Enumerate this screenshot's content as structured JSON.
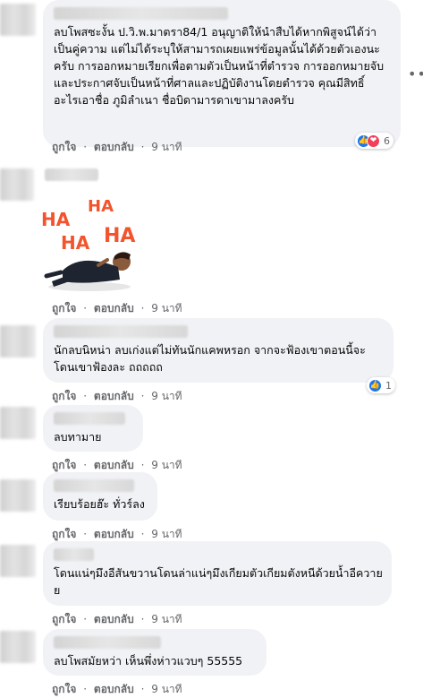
{
  "actions": {
    "like": "ถูกใจ",
    "reply": "ตอบกลับ",
    "sep": "·"
  },
  "comments": [
    {
      "text": "ลบโพสซะงั้น ป.วิ.พ.มาตรา84/1 อนุญาติให้นำสืบได้หากพิสูจน์ได้ว่าเป็นคู่ความ แต่ไม่ได้ระบุให้สามารถเผยแพร่ข้อมูลนั้นได้ด้วยตัวเองนะครับ การออกหมายเรียกเพื่อตามตัวเป็นหน้าที่ตำรวจ การออกหมายจับและประกาศจับเป็นหน้าที่ศาลและปฏิบัติงานโดยตำรวจ คุณมีสิทธิ์อะไรเอาชื่อ ภูมิลำเนา ชื่อบิดามารดาเขามาลงครับ",
      "time": "9 นาที",
      "reactions": {
        "count": "6"
      }
    },
    {
      "sticker": [
        "HA",
        "HA",
        "HA",
        "HA"
      ],
      "time": "9 นาที"
    },
    {
      "text": "นักลบนิหน่า ลบเก่งแต่ไม่ทันนักแคพหรอก จากจะฟ้องเขาตอนนี้จะโดนเขาฟ้องละ ถถถถถ",
      "time": "9 นาที",
      "reactions": {
        "count": "1"
      }
    },
    {
      "text": "ลบทามาย",
      "time": "9 นาที"
    },
    {
      "text": "เรียบร้อยฮ๊ะ ทั่วร์ลง",
      "time": "9 นาที"
    },
    {
      "text": "โดนแน่ๆมึงอีสันขวานโดนล่าแน่ๆมึงเกียมตัวเกียมตังหนีด้วยน้ำอีควายย",
      "time": "9 นาที"
    },
    {
      "text": "ลบโพสมัยหว่า เห็นพึ่งห่าวแวบๆ 55555",
      "time": "9 นาที"
    }
  ],
  "colors": {
    "bubble": "#f0f2f5",
    "like": "#1877f2",
    "love": "#f33e58",
    "meta": "#65676b"
  },
  "icons": {
    "more": "more-horizontal-icon",
    "like": "like-reaction-icon",
    "love": "love-reaction-icon"
  }
}
